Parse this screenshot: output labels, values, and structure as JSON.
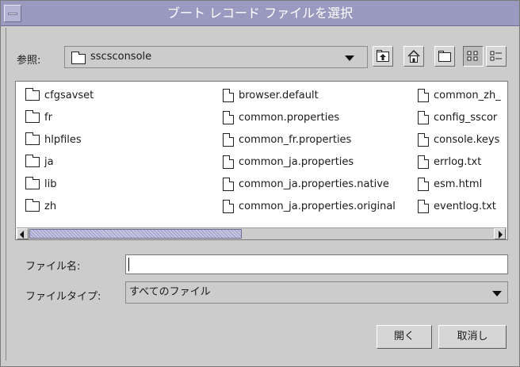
{
  "window": {
    "title": "ブート レコード ファイルを選択",
    "titlebar_color": "#9a9ac0"
  },
  "look_in": {
    "label": "参照:",
    "value": "sscsconsole"
  },
  "toolbar": {
    "icons": [
      "up-folder-icon",
      "home-icon",
      "new-folder-icon",
      "list-view-icon",
      "details-view-icon"
    ]
  },
  "files": {
    "col1": [
      {
        "name": "cfgsavset",
        "type": "folder"
      },
      {
        "name": "fr",
        "type": "folder"
      },
      {
        "name": "hlpfiles",
        "type": "folder"
      },
      {
        "name": "ja",
        "type": "folder"
      },
      {
        "name": "lib",
        "type": "folder"
      },
      {
        "name": "zh",
        "type": "folder"
      }
    ],
    "col2": [
      {
        "name": "browser.default",
        "type": "file"
      },
      {
        "name": "common.properties",
        "type": "file"
      },
      {
        "name": "common_fr.properties",
        "type": "file"
      },
      {
        "name": "common_ja.properties",
        "type": "file"
      },
      {
        "name": "common_ja.properties.native",
        "type": "file"
      },
      {
        "name": "common_ja.properties.original",
        "type": "file"
      }
    ],
    "col3": [
      {
        "name": "common_zh_",
        "type": "file"
      },
      {
        "name": "config_sscor",
        "type": "file"
      },
      {
        "name": "console.keys",
        "type": "file"
      },
      {
        "name": "errlog.txt",
        "type": "file"
      },
      {
        "name": "esm.html",
        "type": "file"
      },
      {
        "name": "eventlog.txt",
        "type": "file"
      }
    ]
  },
  "filename": {
    "label": "ファイル名:",
    "value": ""
  },
  "filetype": {
    "label": "ファイルタイプ:",
    "value": "すべてのファイル"
  },
  "buttons": {
    "open": "開く",
    "cancel": "取消し"
  }
}
